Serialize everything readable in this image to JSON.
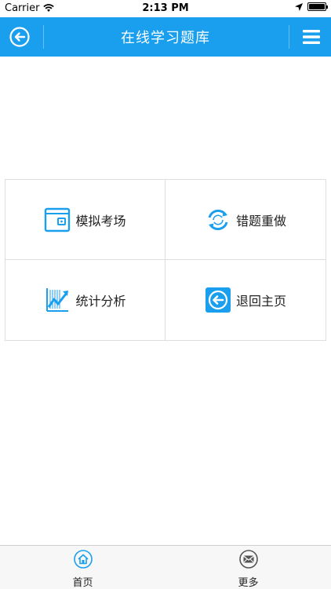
{
  "status_bar": {
    "carrier": "Carrier",
    "time": "2:13 PM"
  },
  "nav": {
    "title": "在线学习题库",
    "back_icon": "back-arrow-circle-icon",
    "menu_icon": "hamburger-menu-icon"
  },
  "grid": {
    "items": [
      {
        "label": "模拟考场",
        "icon": "wallet-icon"
      },
      {
        "label": "错题重做",
        "icon": "refresh-icon"
      },
      {
        "label": "统计分析",
        "icon": "chart-trend-icon"
      },
      {
        "label": "退回主页",
        "icon": "back-arrow-icon"
      }
    ]
  },
  "tabs": [
    {
      "label": "首页",
      "icon": "home-icon"
    },
    {
      "label": "更多",
      "icon": "mail-icon"
    }
  ],
  "colors": {
    "accent": "#1a9fef",
    "icon_blue": "#1a9fef",
    "border": "#dedede"
  }
}
